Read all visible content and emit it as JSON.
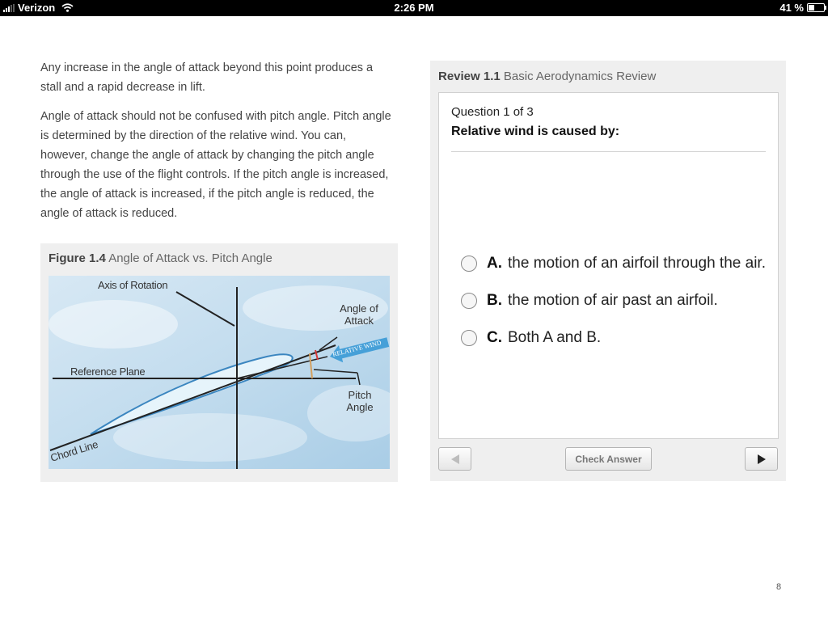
{
  "status_bar": {
    "carrier": "Verizon",
    "time": "2:26 PM",
    "battery_text": "41 %",
    "battery_level": 0.41
  },
  "body": {
    "paragraphs": [
      "Any increase in the angle of attack beyond this point produces a stall and a rapid decrease in lift.",
      "Angle of attack should not be confused with pitch angle. Pitch angle is determined by the direction of the relative wind. You can, however, change the angle of attack by changing the pitch angle through the use of the flight controls. If the pitch angle is increased, the angle of attack is increased, if the pitch angle is reduced, the angle of attack is reduced."
    ]
  },
  "figure": {
    "number": "Figure 1.4",
    "title": "Angle of Attack vs. Pitch Angle",
    "labels": {
      "axis_of_rotation": "Axis of Rotation",
      "angle_of_attack_line1": "Angle of",
      "angle_of_attack_line2": "Attack",
      "relative_wind": "RELATIVE WIND",
      "reference_plane": "Reference Plane",
      "pitch_angle_line1": "Pitch",
      "pitch_angle_line2": "Angle",
      "chord_line": "Chord Line"
    }
  },
  "review": {
    "number": "Review 1.1",
    "title": "Basic Aerodynamics Review",
    "question_count": "Question 1 of 3",
    "question": "Relative wind is caused by:",
    "options": [
      {
        "letter": "A.",
        "text": "the motion of an airfoil through the air."
      },
      {
        "letter": "B.",
        "text": "the motion of air past an airfoil."
      },
      {
        "letter": "C.",
        "text": "Both A and B."
      }
    ],
    "check_answer_label": "Check Answer"
  },
  "page_number": "8",
  "icons": [
    "signal-icon",
    "wifi-icon",
    "battery-icon",
    "radio-icon",
    "prev-arrow-icon",
    "next-arrow-icon"
  ]
}
